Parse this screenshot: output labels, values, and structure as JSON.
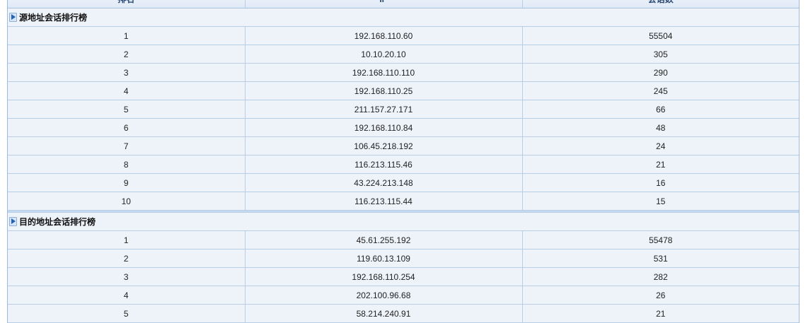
{
  "header": {
    "rank": "排名",
    "ip": "IP",
    "sessions": "会话数"
  },
  "source_section": {
    "title": "源地址会话排行榜",
    "rows": [
      {
        "rank": "1",
        "ip": "192.168.110.60",
        "sessions": "55504"
      },
      {
        "rank": "2",
        "ip": "10.10.20.10",
        "sessions": "305"
      },
      {
        "rank": "3",
        "ip": "192.168.110.110",
        "sessions": "290"
      },
      {
        "rank": "4",
        "ip": "192.168.110.25",
        "sessions": "245"
      },
      {
        "rank": "5",
        "ip": "211.157.27.171",
        "sessions": "66"
      },
      {
        "rank": "6",
        "ip": "192.168.110.84",
        "sessions": "48"
      },
      {
        "rank": "7",
        "ip": "106.45.218.192",
        "sessions": "24"
      },
      {
        "rank": "8",
        "ip": "116.213.115.46",
        "sessions": "21"
      },
      {
        "rank": "9",
        "ip": "43.224.213.148",
        "sessions": "16"
      },
      {
        "rank": "10",
        "ip": "116.213.115.44",
        "sessions": "15"
      }
    ]
  },
  "dest_section": {
    "title": "目的地址会话排行榜",
    "rows": [
      {
        "rank": "1",
        "ip": "45.61.255.192",
        "sessions": "55478"
      },
      {
        "rank": "2",
        "ip": "119.60.13.109",
        "sessions": "531"
      },
      {
        "rank": "3",
        "ip": "192.168.110.254",
        "sessions": "282"
      },
      {
        "rank": "4",
        "ip": "202.100.96.68",
        "sessions": "26"
      },
      {
        "rank": "5",
        "ip": "58.214.240.91",
        "sessions": "21"
      }
    ]
  }
}
